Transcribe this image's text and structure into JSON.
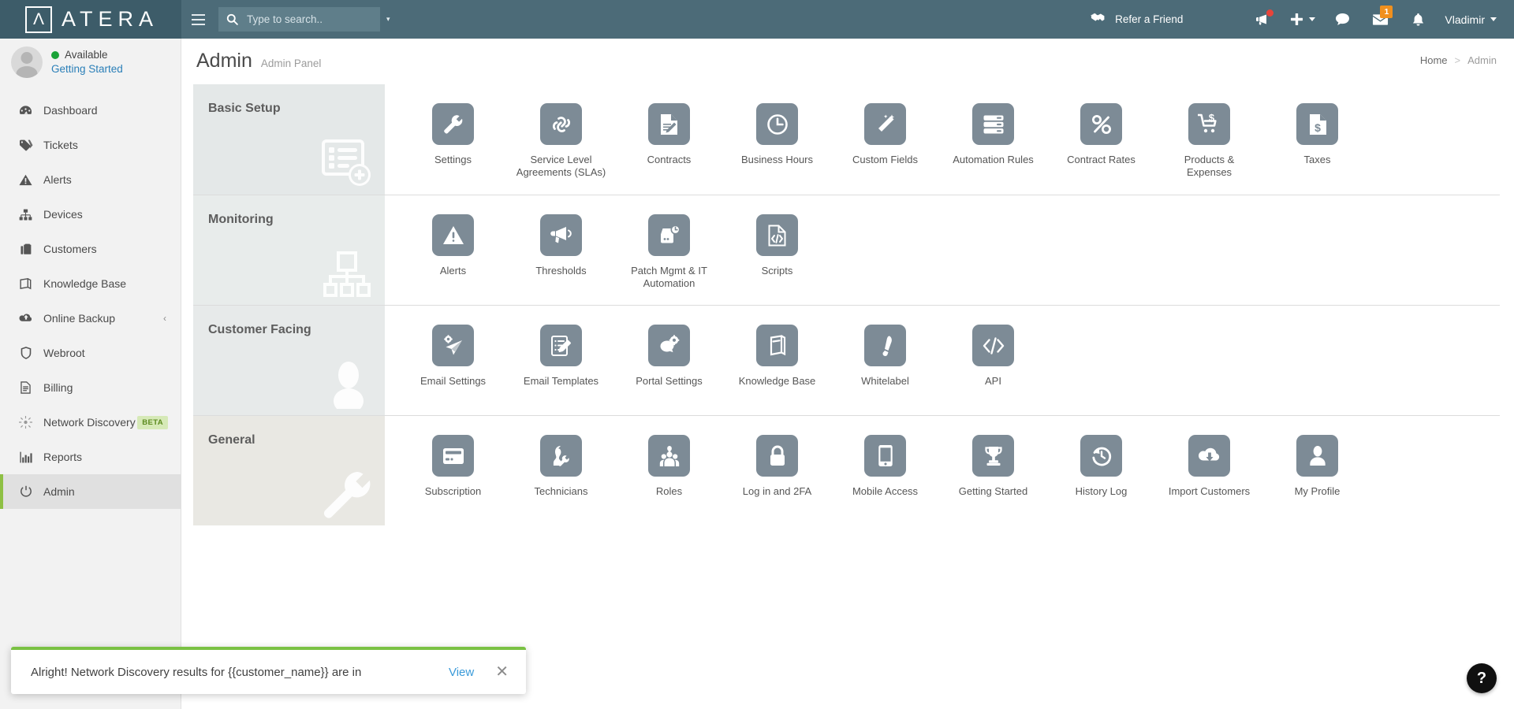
{
  "brand": {
    "name": "ATERA",
    "logo_glyph": "Λ",
    "header_bg": "#4c6b78",
    "logo_bg": "#3d5c69",
    "accent_green": "#8ec044",
    "tile_color": "#7d8b96"
  },
  "topbar": {
    "menu_icon": "hamburger-icon",
    "search": {
      "placeholder": "Type to search..",
      "value": "",
      "icon": "search-icon",
      "caret": "▾"
    },
    "refer": {
      "label": "Refer a Friend",
      "icon": "handshake-icon"
    },
    "icons": [
      {
        "name": "megaphone-icon",
        "badge": "",
        "has_dot": true
      },
      {
        "name": "plus-icon",
        "badge": "",
        "has_dot": false
      },
      {
        "name": "chat-icon",
        "badge": "",
        "has_dot": false
      },
      {
        "name": "envelope-icon",
        "badge": "1",
        "has_dot": false
      },
      {
        "name": "bell-icon",
        "badge": "",
        "has_dot": false
      }
    ],
    "user": {
      "name": "Vladimir",
      "caret": "▾"
    }
  },
  "sidebar": {
    "profile": {
      "status": "Available",
      "status_color": "#1aa338",
      "link": "Getting Started"
    },
    "items": [
      {
        "label": "Dashboard",
        "icon": "dashboard-icon",
        "active": false,
        "badge": "",
        "chevron": ""
      },
      {
        "label": "Tickets",
        "icon": "ticket-icon",
        "active": false,
        "badge": "",
        "chevron": ""
      },
      {
        "label": "Alerts",
        "icon": "alert-triangle-icon",
        "active": false,
        "badge": "",
        "chevron": ""
      },
      {
        "label": "Devices",
        "icon": "sitemap-icon",
        "active": false,
        "badge": "",
        "chevron": ""
      },
      {
        "label": "Customers",
        "icon": "briefcase-icon",
        "active": false,
        "badge": "",
        "chevron": ""
      },
      {
        "label": "Knowledge Base",
        "icon": "book-icon",
        "active": false,
        "badge": "",
        "chevron": ""
      },
      {
        "label": "Online Backup",
        "icon": "cloud-upload-icon",
        "active": false,
        "badge": "",
        "chevron": "‹"
      },
      {
        "label": "Webroot",
        "icon": "shield-icon",
        "active": false,
        "badge": "",
        "chevron": ""
      },
      {
        "label": "Billing",
        "icon": "file-text-icon",
        "active": false,
        "badge": "",
        "chevron": ""
      },
      {
        "label": "Network Discovery",
        "icon": "network-discovery-icon",
        "active": false,
        "badge": "BETA",
        "chevron": ""
      },
      {
        "label": "Reports",
        "icon": "bar-chart-icon",
        "active": false,
        "badge": "",
        "chevron": ""
      },
      {
        "label": "Admin",
        "icon": "power-icon",
        "active": true,
        "badge": "",
        "chevron": ""
      }
    ]
  },
  "page": {
    "title": "Admin",
    "subtitle": "Admin Panel",
    "breadcrumb": {
      "home": "Home",
      "separator": ">",
      "current": "Admin"
    }
  },
  "sections": [
    {
      "title": "Basic Setup",
      "watermark_icon": "list-add-icon",
      "tiles": [
        {
          "label": "Settings",
          "icon": "wrench-icon"
        },
        {
          "label": "Service Level Agreements (SLAs)",
          "icon": "link-chain-icon"
        },
        {
          "label": "Contracts",
          "icon": "contract-document-icon"
        },
        {
          "label": "Business Hours",
          "icon": "clock-icon"
        },
        {
          "label": "Custom Fields",
          "icon": "magic-wand-icon"
        },
        {
          "label": "Automation Rules",
          "icon": "server-rules-icon"
        },
        {
          "label": "Contract Rates",
          "icon": "percent-icon"
        },
        {
          "label": "Products & Expenses",
          "icon": "cart-dollar-icon"
        },
        {
          "label": "Taxes",
          "icon": "document-dollar-icon"
        }
      ]
    },
    {
      "title": "Monitoring",
      "watermark_icon": "hierarchy-icon",
      "tiles": [
        {
          "label": "Alerts",
          "icon": "alert-triangle-icon"
        },
        {
          "label": "Thresholds",
          "icon": "megaphone-icon"
        },
        {
          "label": "Patch Mgmt & IT Automation",
          "icon": "patch-clock-icon"
        },
        {
          "label": "Scripts",
          "icon": "code-file-icon"
        }
      ]
    },
    {
      "title": "Customer Facing",
      "watermark_icon": "user-silhouette-icon",
      "tiles": [
        {
          "label": "Email Settings",
          "icon": "send-gear-icon"
        },
        {
          "label": "Email Templates",
          "icon": "template-edit-icon"
        },
        {
          "label": "Portal Settings",
          "icon": "chat-gear-icon"
        },
        {
          "label": "Knowledge Base",
          "icon": "book-icon"
        },
        {
          "label": "Whitelabel",
          "icon": "paintbrush-icon"
        },
        {
          "label": "API",
          "icon": "code-brackets-icon"
        }
      ]
    },
    {
      "title": "General",
      "watermark_icon": "wrench-icon",
      "tiles": [
        {
          "label": "Subscription",
          "icon": "credit-card-icon"
        },
        {
          "label": "Technicians",
          "icon": "technician-icon"
        },
        {
          "label": "Roles",
          "icon": "roles-users-icon"
        },
        {
          "label": "Log in and 2FA",
          "icon": "padlock-icon"
        },
        {
          "label": "Mobile Access",
          "icon": "mobile-phone-icon"
        },
        {
          "label": "Getting Started",
          "icon": "trophy-icon"
        },
        {
          "label": "History Log",
          "icon": "history-clock-icon"
        },
        {
          "label": "Import Customers",
          "icon": "cloud-download-icon"
        },
        {
          "label": "My Profile",
          "icon": "user-icon"
        }
      ]
    }
  ],
  "toast": {
    "message": "Alright! Network Discovery results for {{customer_name}} are in",
    "action": "View",
    "close": "✕",
    "accent": "#7ac143"
  },
  "help": {
    "label": "?"
  }
}
